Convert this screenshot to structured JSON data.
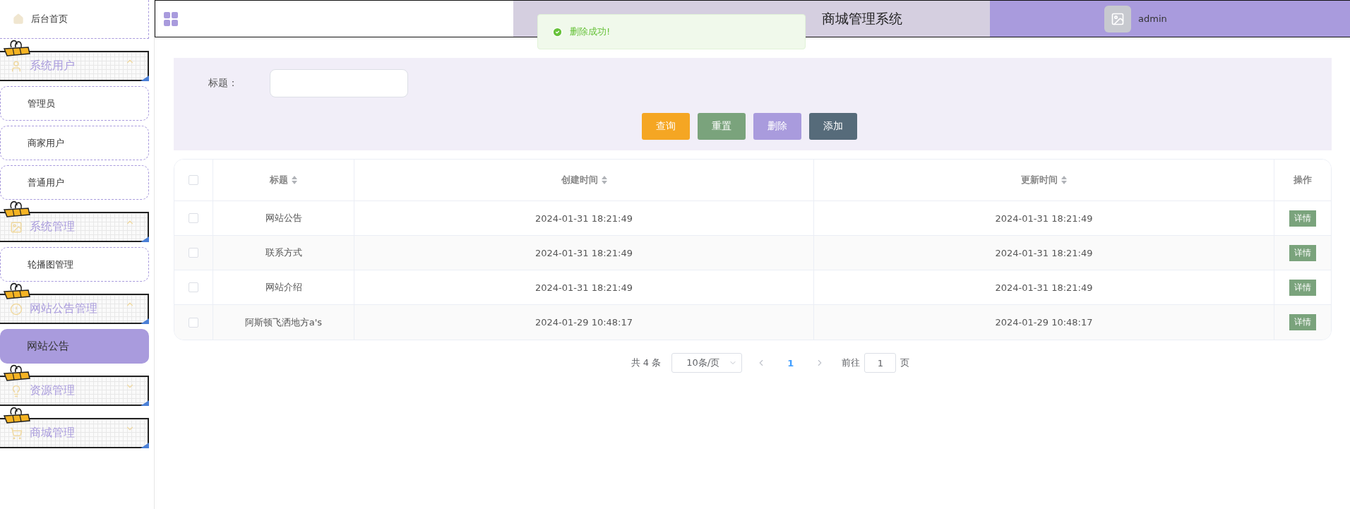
{
  "sidebar": {
    "home": {
      "label": "后台首页"
    },
    "groups": [
      {
        "label": "系统用户",
        "expanded": true,
        "items": [
          {
            "label": "管理员",
            "selected": false
          },
          {
            "label": "商家用户",
            "selected": false
          },
          {
            "label": "普通用户",
            "selected": false
          }
        ]
      },
      {
        "label": "系统管理",
        "expanded": true,
        "items": [
          {
            "label": "轮播图管理",
            "selected": false
          }
        ]
      },
      {
        "label": "网站公告管理",
        "expanded": true,
        "items": [
          {
            "label": "网站公告",
            "selected": true
          }
        ]
      },
      {
        "label": "资源管理",
        "expanded": false
      },
      {
        "label": "商城管理",
        "expanded": false
      }
    ]
  },
  "header": {
    "title": "商城管理系统",
    "user": "admin"
  },
  "toast": {
    "message": "删除成功!"
  },
  "search": {
    "label": "标题："
  },
  "buttons": [
    {
      "label": "查询",
      "kind": "search"
    },
    {
      "label": "重置",
      "kind": "reset"
    },
    {
      "label": "删除",
      "kind": "delete"
    },
    {
      "label": "添加",
      "kind": "add"
    }
  ],
  "table": {
    "select_all_checked": false,
    "columns": [
      {
        "label": "标题",
        "sortable": true
      },
      {
        "label": "创建时间",
        "sortable": true
      },
      {
        "label": "更新时间",
        "sortable": true
      },
      {
        "label": "操作",
        "sortable": false
      }
    ],
    "rows": [
      {
        "checked": false,
        "cells": [
          "网站公告",
          "2024-01-31 18:21:49",
          "2024-01-31 18:21:49"
        ],
        "action": "详情"
      },
      {
        "checked": false,
        "cells": [
          "联系方式",
          "2024-01-31 18:21:49",
          "2024-01-31 18:21:49"
        ],
        "action": "详情"
      },
      {
        "checked": false,
        "cells": [
          "网站介绍",
          "2024-01-31 18:21:49",
          "2024-01-31 18:21:49"
        ],
        "action": "详情"
      },
      {
        "checked": false,
        "cells": [
          "阿斯顿飞洒地方a's",
          "2024-01-29 10:48:17",
          "2024-01-29 10:48:17"
        ],
        "action": "详情"
      }
    ]
  },
  "pagination": {
    "total": "共 4 条",
    "page_size": "10条/页",
    "pages": [
      {
        "label": "1",
        "selected": true
      }
    ],
    "goto_label": "前往",
    "goto_value": "1",
    "goto_suffix": "页"
  }
}
